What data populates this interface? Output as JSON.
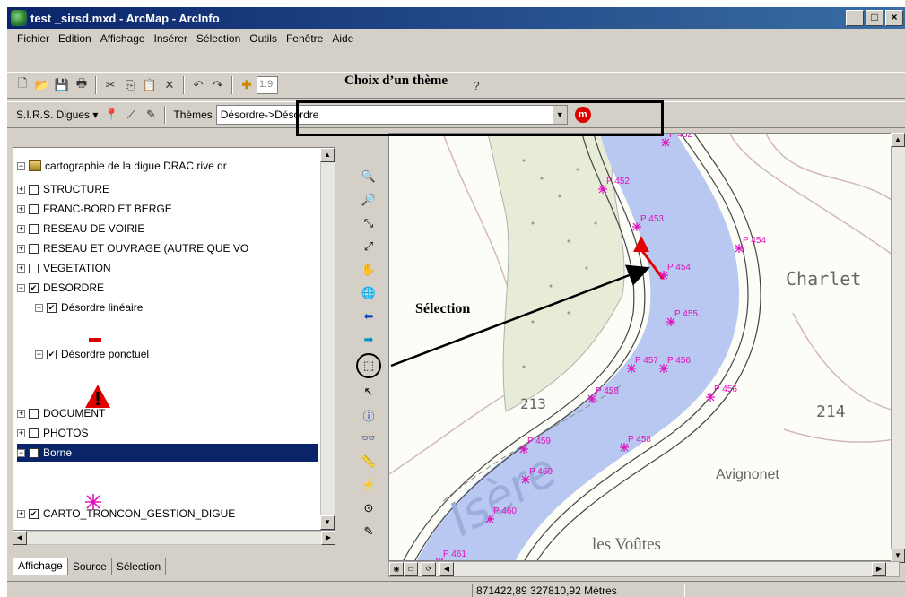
{
  "window": {
    "title": "test _sirsd.mxd - ArcMap - ArcInfo",
    "controls": [
      "_",
      "□",
      "×"
    ]
  },
  "menu": [
    "Fichier",
    "Edition",
    "Affichage",
    "Insérer",
    "Sélection",
    "Outils",
    "Fenêtre",
    "Aide"
  ],
  "toolbar1": {
    "scale_value": "1:9"
  },
  "toolbar2": {
    "sirs_menu": "S.I.R.S. Digues ▾",
    "themes_label": "Thèmes",
    "theme_value": "Désordre->Désordre"
  },
  "annotations": {
    "choix_theme": "Choix d’un thème",
    "selection": "Sélection"
  },
  "toc": {
    "root": "cartographie de la digue DRAC rive dr",
    "layers": [
      {
        "label": "STRUCTURE",
        "expander": "+",
        "checked": false
      },
      {
        "label": "FRANC-BORD ET BERGE",
        "expander": "+",
        "checked": false
      },
      {
        "label": "RESEAU DE VOIRIE",
        "expander": "+",
        "checked": false
      },
      {
        "label": "RESEAU ET OUVRAGE (AUTRE QUE VO",
        "expander": "+",
        "checked": false
      },
      {
        "label": "VEGETATION",
        "expander": "+",
        "checked": false
      },
      {
        "label": "DESORDRE",
        "expander": "−",
        "checked": true
      },
      {
        "label": "Désordre linéaire",
        "expander": "−",
        "checked": true
      },
      {
        "label": "Désordre ponctuel",
        "expander": "−",
        "checked": true
      },
      {
        "label": "DOCUMENT",
        "expander": "+",
        "checked": false
      },
      {
        "label": "PHOTOS",
        "expander": "+",
        "checked": false
      },
      {
        "label": "Borne",
        "expander": "−",
        "checked": true
      },
      {
        "label": "CARTO_TRONCON_GESTION_DIGUE",
        "expander": "+",
        "checked": true
      }
    ],
    "tabs": [
      "Affichage",
      "Source",
      "Sélection"
    ]
  },
  "map": {
    "borne_labels": [
      "P 452",
      "P 452",
      "P 453",
      "P 454",
      "P 454",
      "P 455",
      "P 456",
      "P 456",
      "P 457",
      "P 458",
      "P 458",
      "P 459",
      "P 460",
      "P 460",
      "P 461"
    ],
    "place_names": [
      "Charlet",
      "214",
      "Avignonet",
      "les Voûtes",
      "213"
    ],
    "river_label": "Isère"
  },
  "status": {
    "coordinates": "871422,89  327810,92 Mètres"
  },
  "colors": {
    "title_bar": "#0a246a",
    "river": "#b8c8f0",
    "borne": "#e010c0",
    "desordre": "#e00000"
  }
}
